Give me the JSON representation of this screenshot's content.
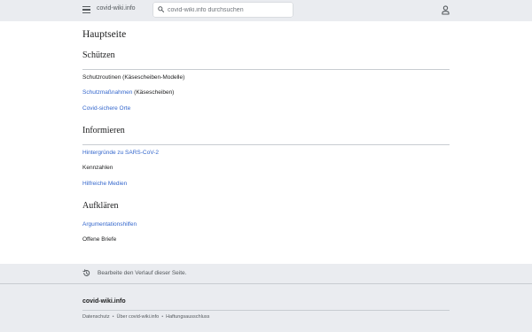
{
  "header": {
    "site_name": "covid-wiki.info",
    "search_placeholder": "covid-wiki.info durchsuchen"
  },
  "page": {
    "title": "Hauptseite"
  },
  "sections": [
    {
      "heading": "Schützen",
      "items": [
        {
          "link": "",
          "text": "Schutzroutinen (Käsescheiben-Modelle)"
        },
        {
          "link": "Schutzmaßnahmen",
          "text": " (Käsescheiben)"
        },
        {
          "link": "Covid-sichere Orte",
          "text": ""
        }
      ]
    },
    {
      "heading": "Informieren",
      "items": [
        {
          "link": "Hintergründe zu SARS-CoV-2",
          "text": ""
        },
        {
          "link": "",
          "text": "Kennzahlen"
        },
        {
          "link": "Hilfreiche Medien",
          "text": ""
        }
      ]
    },
    {
      "heading": "Aufklären",
      "items": [
        {
          "link": "Argumentationshilfen",
          "text": ""
        },
        {
          "link": "",
          "text": "Offene Briefe"
        }
      ]
    }
  ],
  "history": {
    "text": "Bearbeite den Verlauf dieser Seite."
  },
  "footer": {
    "site_name": "covid-wiki.info",
    "links": [
      "Datenschutz",
      "Über covid-wiki.info",
      "Haftungsausschluss"
    ],
    "separator": "•"
  },
  "colors": {
    "link": "#3366cc",
    "text": "#202122",
    "chrome": "#eaecf0"
  },
  "icons": {
    "menu": "hamburger-menu-icon",
    "search": "search-icon",
    "user": "user-icon",
    "history": "history-icon"
  }
}
